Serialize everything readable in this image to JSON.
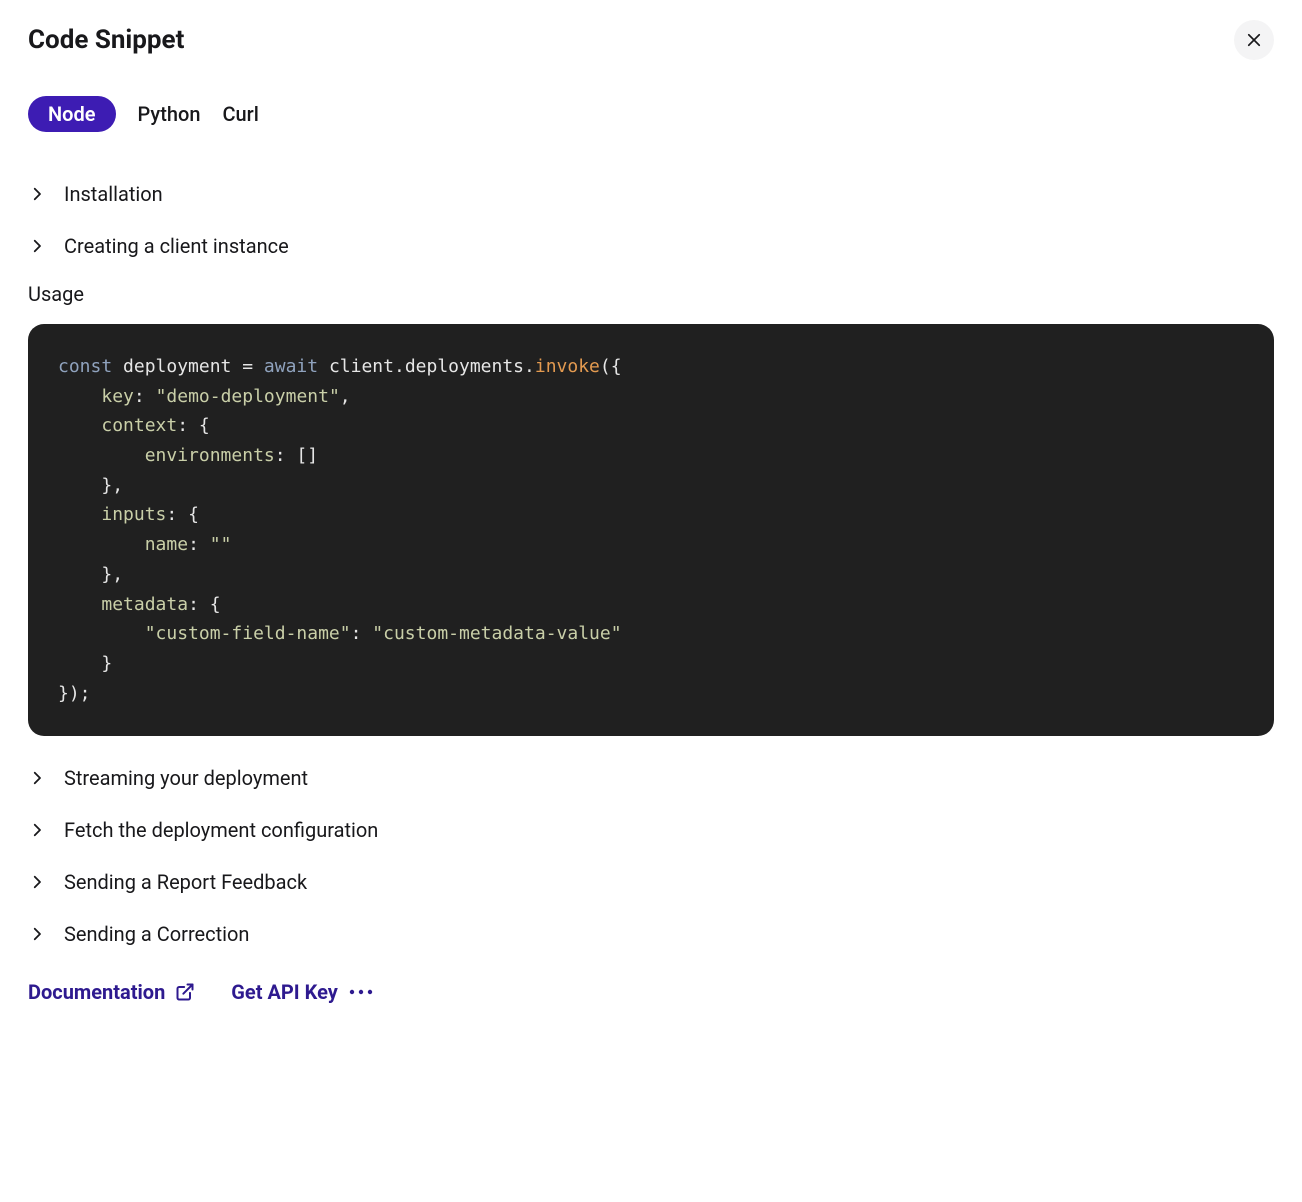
{
  "title": "Code Snippet",
  "tabs": {
    "node": "Node",
    "python": "Python",
    "curl": "Curl"
  },
  "sections": {
    "installation": "Installation",
    "creating_client": "Creating a client instance",
    "usage_label": "Usage",
    "streaming": "Streaming your deployment",
    "fetch_config": "Fetch the deployment configuration",
    "report_feedback": "Sending a Report Feedback",
    "correction": "Sending a Correction"
  },
  "code": {
    "kw_const": "const",
    "id_deployment": " deployment ",
    "eq": "= ",
    "kw_await": "await",
    "id_client": " client",
    "dot1": ".",
    "id_deployments": "deployments",
    "dot2": ".",
    "call_invoke": "invoke",
    "open_paren": "({",
    "prop_key": "key",
    "colon1": ": ",
    "str_demo": "\"demo-deployment\"",
    "comma1": ",",
    "prop_context": "context",
    "colon2": ": {",
    "prop_env": "environments",
    "colon3": ": []",
    "close1": "},",
    "prop_inputs": "inputs",
    "colon4": ": {",
    "prop_name": "name",
    "colon5": ": ",
    "str_empty": "\"\"",
    "close2": "},",
    "prop_meta": "metadata",
    "colon6": ": {",
    "str_cfn_key": "\"custom-field-name\"",
    "colon7": ": ",
    "str_cfn_val": "\"custom-metadata-value\"",
    "close3": "}",
    "close4": "});"
  },
  "footer": {
    "documentation": "Documentation",
    "get_api_key": "Get API Key"
  }
}
